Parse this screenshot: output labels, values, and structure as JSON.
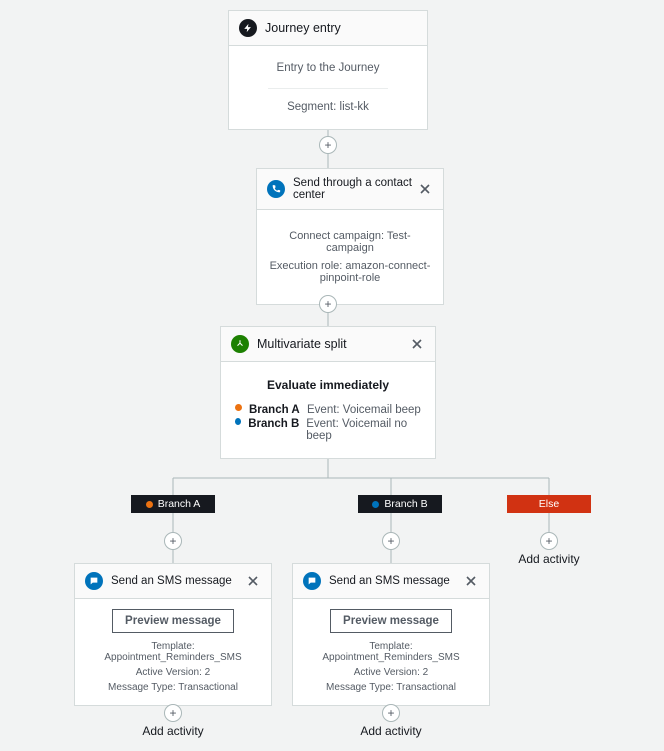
{
  "entry": {
    "title": "Journey entry",
    "subtitle": "Entry to the Journey",
    "segment_label": "Segment: list-kk"
  },
  "contactCenter": {
    "title": "Send through a contact center",
    "line1": "Connect campaign: Test-campaign",
    "line2": "Execution role: amazon-connect-pinpoint-role"
  },
  "split": {
    "title": "Multivariate split",
    "heading": "Evaluate immediately",
    "branches": [
      {
        "label": "Branch A",
        "detail": "Event: Voicemail beep"
      },
      {
        "label": "Branch B",
        "detail": "Event: Voicemail no beep"
      }
    ]
  },
  "pills": {
    "a": "Branch A",
    "b": "Branch B",
    "else": "Else"
  },
  "sms": {
    "title": "Send an SMS message",
    "preview": "Preview message",
    "template": "Template: Appointment_Reminders_SMS",
    "version": "Active Version: 2",
    "msgtype": "Message Type: Transactional"
  },
  "addActivity": "Add activity",
  "colors": {
    "orange": "#ec7211",
    "blue": "#0073bb",
    "red": "#d13212",
    "green": "#1d8102",
    "phone": "#0073bb",
    "entryicon": "#16191f",
    "smsIcon": "#0073bb"
  }
}
